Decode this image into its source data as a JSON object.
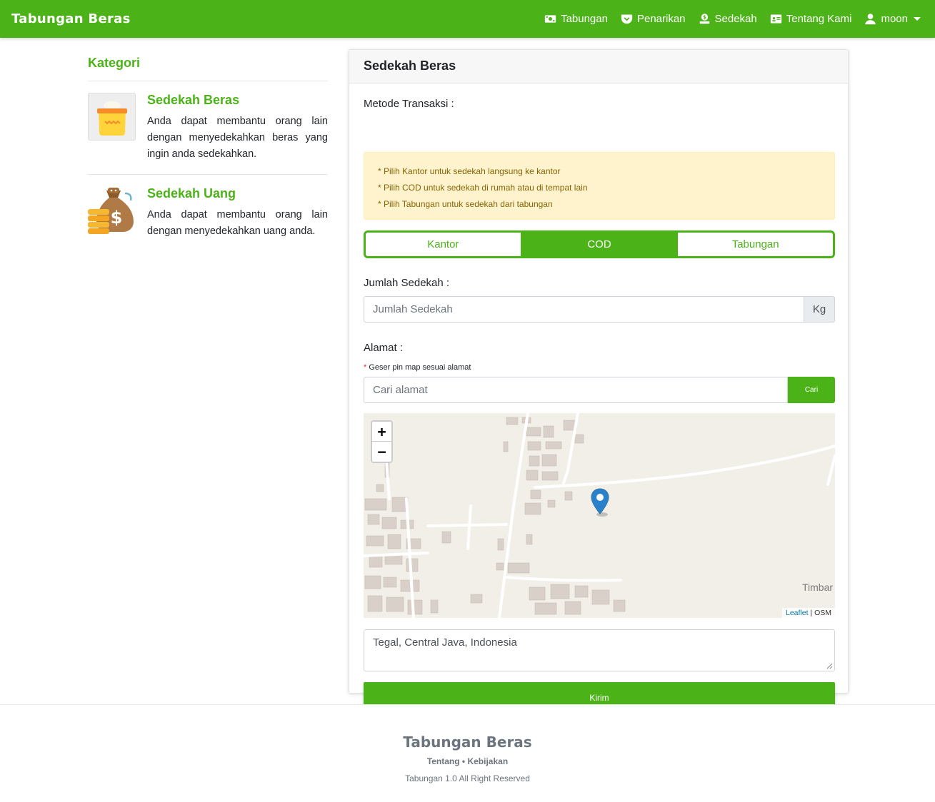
{
  "navbar": {
    "brand": "Tabungan Beras",
    "items": [
      {
        "label": "Tabungan",
        "icon": "money-bill-icon"
      },
      {
        "label": "Penarikan",
        "icon": "pocket-icon"
      },
      {
        "label": "Sedekah",
        "icon": "donate-icon"
      },
      {
        "label": "Tentang Kami",
        "icon": "id-card-icon"
      }
    ],
    "user": {
      "label": "moon",
      "icon": "user-icon"
    }
  },
  "sidebar": {
    "title": "Kategori",
    "categories": [
      {
        "title": "Sedekah Beras",
        "description": "Anda dapat membantu orang lain dengan menyedekahkan beras yang ingin anda sedekahkan.",
        "icon": "rice-sack-icon"
      },
      {
        "title": "Sedekah Uang",
        "description": "Anda dapat membantu orang lain dengan menyedekahkan uang anda.",
        "icon": "money-bag-icon"
      }
    ]
  },
  "form": {
    "title": "Sedekah Beras",
    "metode_label": "Metode Transaksi :",
    "notes": [
      "* Pilih Kantor untuk sedekah langsung ke kantor",
      "* Pilih COD untuk sedekah di rumah atau di tempat lain",
      "* Pilih Tabungan untuk sedekah dari tabungan"
    ],
    "methods": [
      {
        "label": "Kantor",
        "active": false
      },
      {
        "label": "COD",
        "active": true
      },
      {
        "label": "Tabungan",
        "active": false
      }
    ],
    "jumlah_label": "Jumlah Sedekah :",
    "jumlah_placeholder": "Jumlah Sedekah",
    "jumlah_unit": "Kg",
    "alamat_label": "Alamat :",
    "alamat_hint_marker": "*",
    "alamat_hint": "Geser pin map sesuai alamat",
    "search_placeholder": "Cari alamat",
    "search_button": "Cari",
    "map": {
      "zoom_in": "+",
      "zoom_out": "−",
      "place_label": "Timbar",
      "attribution_link": "Leaflet",
      "attribution_sep": " | ",
      "attribution_text": "OSM"
    },
    "address_value": "Tegal, Central Java, Indonesia",
    "submit_label": "Kirim"
  },
  "footer": {
    "brand": "Tabungan Beras",
    "link_tentang": "Tentang",
    "link_sep": " • ",
    "link_kebijakan": "Kebijakan",
    "copyright": "Tabungan 1.0 All Right Reserved"
  },
  "colors": {
    "primary": "#4bb317",
    "alert_bg": "#fff3cd",
    "alert_text": "#856404"
  }
}
